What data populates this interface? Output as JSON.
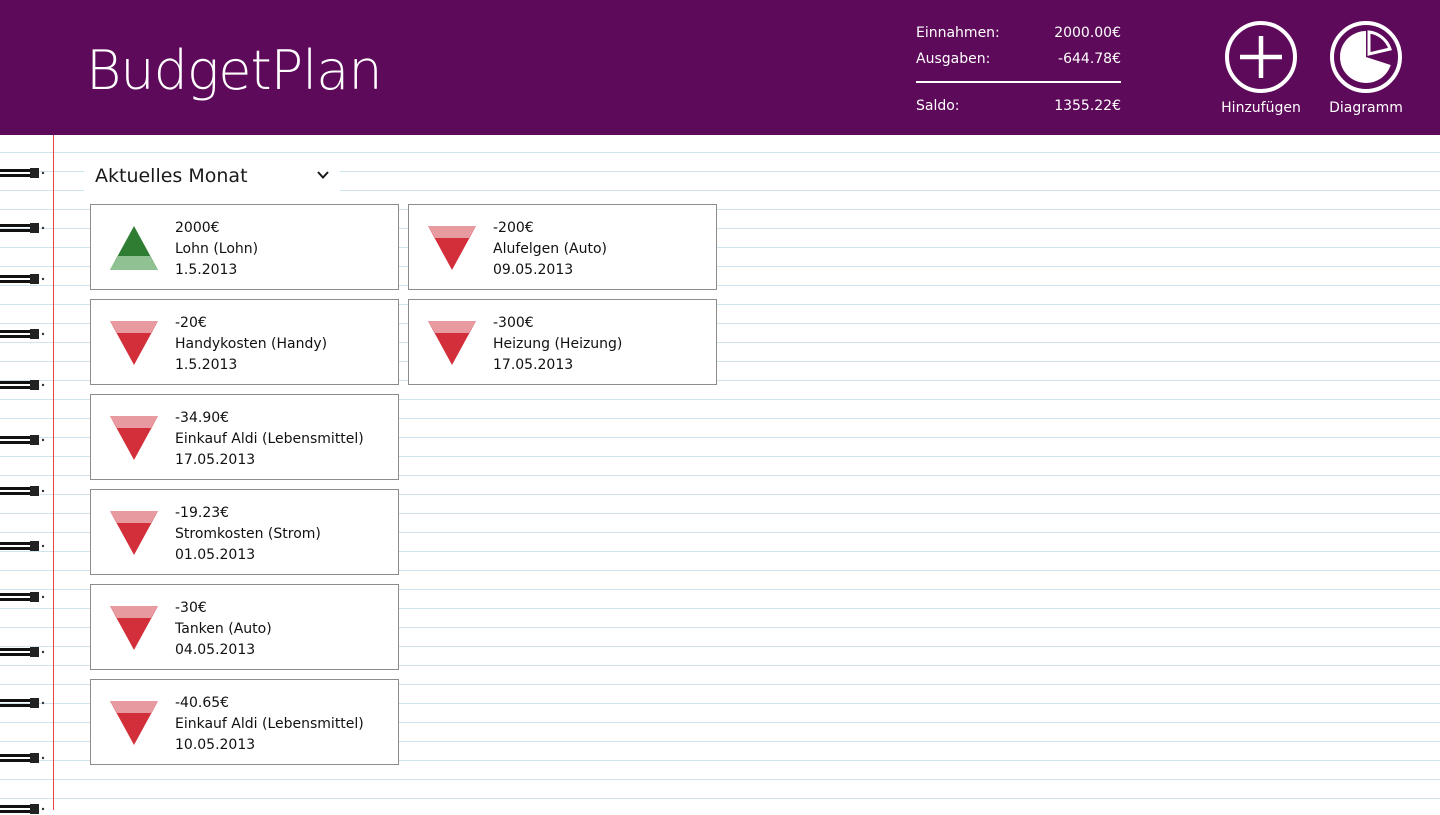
{
  "header": {
    "title": "BudgetPlan",
    "summary": {
      "income_label": "Einnahmen:",
      "income_value": "2000.00€",
      "expenses_label": "Ausgaben:",
      "expenses_value": "-644.78€",
      "balance_label": "Saldo:",
      "balance_value": "1355.22€"
    },
    "buttons": {
      "add_label": "Hinzufügen",
      "add_icon": "plus-circle-icon",
      "chart_label": "Diagramm",
      "chart_icon": "pie-chart-icon"
    }
  },
  "filter": {
    "selected": "Aktuelles Monat",
    "icon": "chevron-down-icon"
  },
  "colors": {
    "header_bg": "#5e0a5b",
    "income_arrow": "#2e7d32",
    "expense_arrow": "#d32f3a",
    "margin_line": "#e8454a",
    "ruled_line": "#cfe4ee"
  },
  "entries": [
    {
      "type": "income",
      "amount": "2000€",
      "description": "Lohn (Lohn)",
      "date": "1.5.2013"
    },
    {
      "type": "expense",
      "amount": "-200€",
      "description": "Alufelgen (Auto)",
      "date": "09.05.2013"
    },
    {
      "type": "expense",
      "amount": "-20€",
      "description": "Handykosten (Handy)",
      "date": "1.5.2013"
    },
    {
      "type": "expense",
      "amount": "-300€",
      "description": "Heizung (Heizung)",
      "date": "17.05.2013"
    },
    {
      "type": "expense",
      "amount": "-34.90€",
      "description": "Einkauf Aldi (Lebensmittel)",
      "date": "17.05.2013"
    },
    {
      "type": "expense",
      "amount": "-19.23€",
      "description": "Stromkosten (Strom)",
      "date": "01.05.2013"
    },
    {
      "type": "expense",
      "amount": "-30€",
      "description": "Tanken (Auto)",
      "date": "04.05.2013"
    },
    {
      "type": "expense",
      "amount": "-40.65€",
      "description": "Einkauf Aldi (Lebensmittel)",
      "date": "10.05.2013"
    }
  ]
}
